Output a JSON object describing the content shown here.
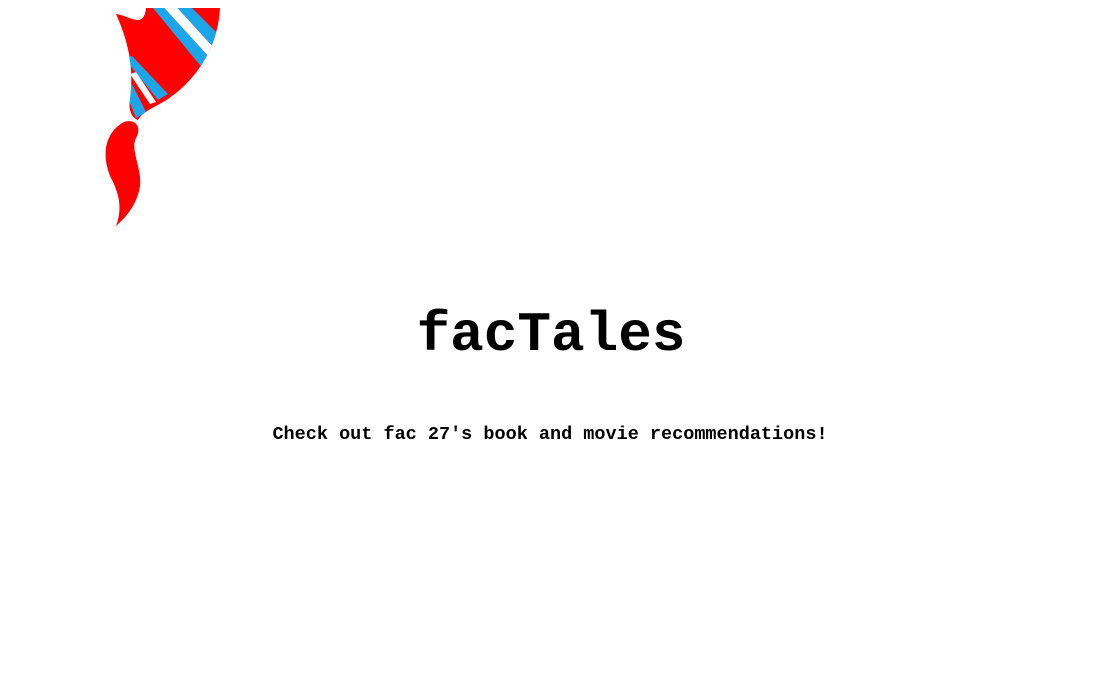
{
  "header": {
    "logo_icon": "striped-hat-icon",
    "logo_colors": {
      "red": "#ff0000",
      "blue": "#1aa6e8"
    }
  },
  "main": {
    "title": "facTales",
    "tagline": "Check out fac 27's book and movie recommendations!"
  }
}
